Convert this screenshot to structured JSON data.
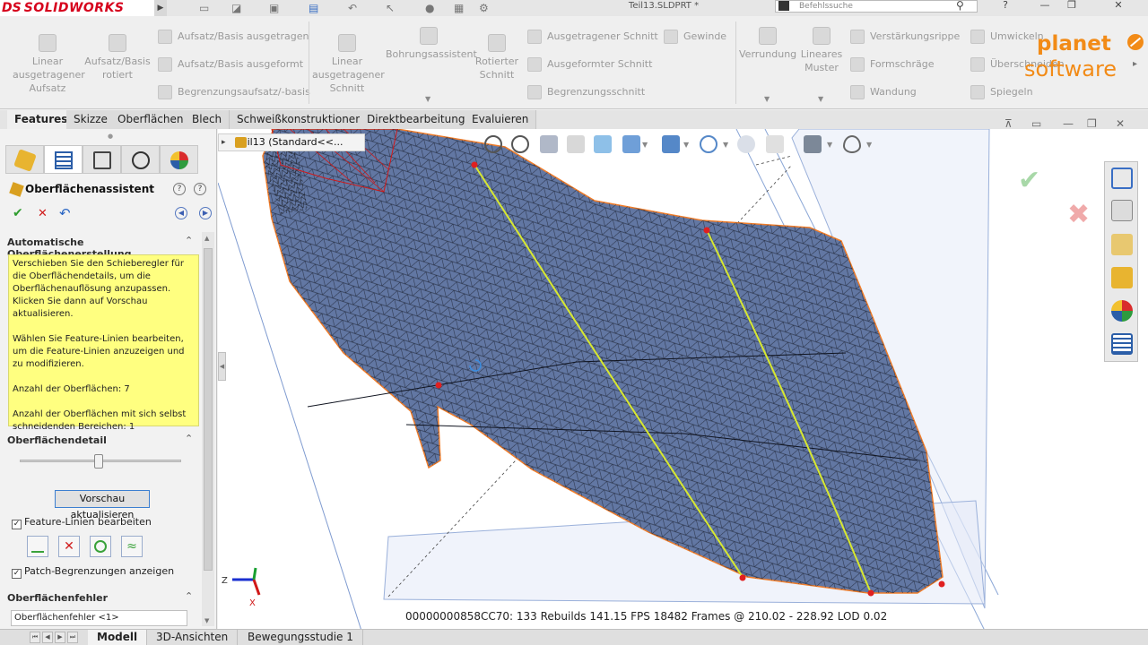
{
  "app": {
    "brand": "SOLIDWORKS",
    "brand_mark": "DS",
    "document_title": "Teil13.SLDPRT *",
    "search_placeholder": "Befehlssuche",
    "help_label": "?"
  },
  "ribbon": {
    "large_buttons": [
      {
        "label": "Linear ausgetragener Aufsatz",
        "icon": "extrude-boss-icon"
      },
      {
        "label": "Aufsatz/Basis rotiert",
        "icon": "revolve-boss-icon"
      },
      {
        "label": "Linear ausgetragener Schnitt",
        "icon": "extrude-cut-icon"
      },
      {
        "label": "Bohrungsassistent",
        "icon": "hole-wizard-icon"
      },
      {
        "label": "Rotierter Schnitt",
        "icon": "revolve-cut-icon"
      },
      {
        "label": "Verrundung",
        "icon": "fillet-icon"
      },
      {
        "label": "Lineares Muster",
        "icon": "linear-pattern-icon"
      }
    ],
    "small_buttons": [
      {
        "label": "Aufsatz/Basis ausgetragen",
        "icon": "swept-boss-icon"
      },
      {
        "label": "Aufsatz/Basis ausgeformt",
        "icon": "lofted-boss-icon"
      },
      {
        "label": "Begrenzungsaufsatz/-basis",
        "icon": "boundary-boss-icon"
      },
      {
        "label": "Ausgetragener Schnitt",
        "icon": "swept-cut-icon"
      },
      {
        "label": "Ausgeformter Schnitt",
        "icon": "lofted-cut-icon"
      },
      {
        "label": "Begrenzungsschnitt",
        "icon": "boundary-cut-icon"
      },
      {
        "label": "Gewinde",
        "icon": "thread-icon"
      },
      {
        "label": "Verstärkungsrippe",
        "icon": "rib-icon"
      },
      {
        "label": "Formschräge",
        "icon": "draft-icon"
      },
      {
        "label": "Wandung",
        "icon": "shell-icon"
      },
      {
        "label": "Umwickeln",
        "icon": "wrap-icon"
      },
      {
        "label": "Überschneiden",
        "icon": "intersect-icon"
      },
      {
        "label": "Spiegeln",
        "icon": "mirror-icon"
      }
    ]
  },
  "brand_logo": {
    "line1": "planet",
    "line2": "software"
  },
  "tabs": [
    "Features",
    "Skizze",
    "Oberflächen",
    "Blech",
    "Schweißkonstruktionen",
    "Direktbearbeitung",
    "Evaluieren"
  ],
  "property_manager": {
    "title": "Oberflächenassistent",
    "groups": {
      "auto": "Automatische Oberflächenerstellung",
      "detail": "Oberflächendetail",
      "errors": "Oberflächenfehler"
    },
    "message": [
      "Verschieben Sie den Schieberegler für die Oberflächendetails, um die Oberflächenauflösung anzupassen. Klicken Sie dann auf Vorschau aktualisieren.",
      "Wählen Sie Feature-Linien bearbeiten, um die Feature-Linien anzuzeigen und zu modifizieren.",
      "Anzahl der Oberflächen: 7",
      "Anzahl der Oberflächen mit sich selbst schneidenden Bereichen: 1"
    ],
    "slider_fraction": 0.49,
    "preview_button": "Vorschau aktualisieren",
    "checkboxes": {
      "edit_feature_lines": "Feature-Linien bearbeiten",
      "show_patch_bounds": "Patch-Begrenzungen anzeigen"
    },
    "error_item": "Oberflächenfehler <1>"
  },
  "viewport": {
    "tree_flyout": "Teil13  (Standard<<...",
    "status": "00000000858CC70:    133  Rebuilds 141.15 FPS  18482 Frames @ 210.02 - 228.92 LOD 0.02",
    "triad_z": "Z",
    "triad_x": "X"
  },
  "bottom_tabs": [
    "Modell",
    "3D-Ansichten",
    "Bewegungsstudie 1"
  ],
  "colors": {
    "mesh_fill": "#6277a3",
    "mesh_wire": "#111111",
    "feature_line": "#d8e830",
    "brand_orange": "#f28b17",
    "message_bg": "#ffff80",
    "brand_red": "#d6001c"
  }
}
